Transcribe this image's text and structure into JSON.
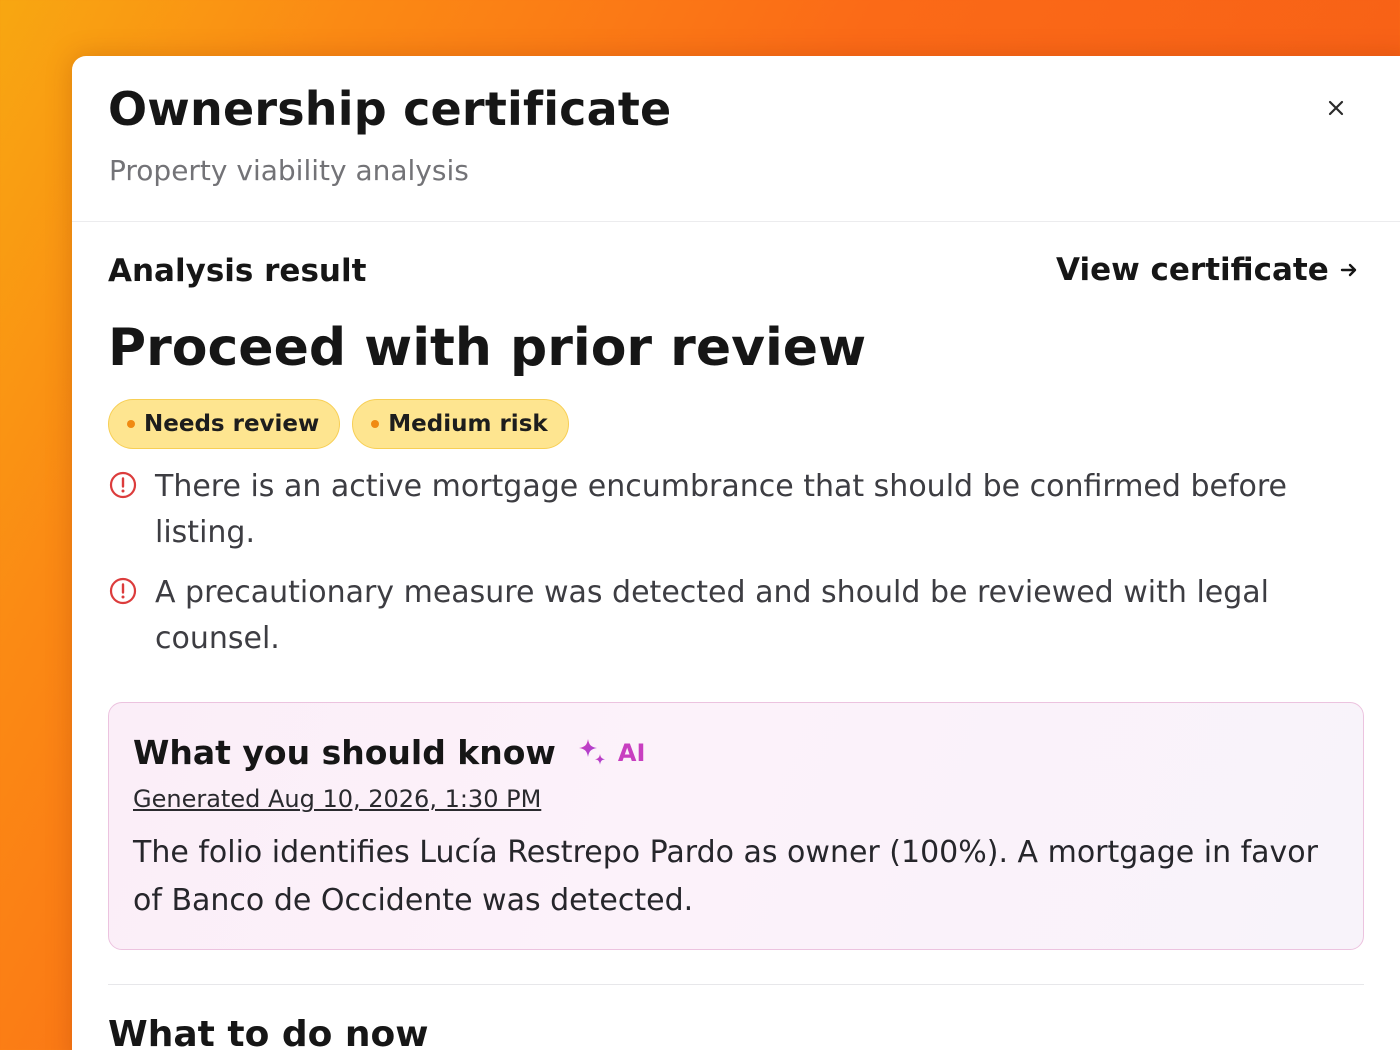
{
  "modal": {
    "title": "Ownership certificate",
    "subtitle": "Property viability analysis"
  },
  "analysis": {
    "section_label": "Analysis result",
    "view_certificate_label": "View certificate",
    "verdict": "Proceed with prior review",
    "badges": [
      {
        "label": "Needs review"
      },
      {
        "label": "Medium risk"
      }
    ],
    "warnings": [
      {
        "text": "There is an active mortgage encumbrance that should be confirmed before listing."
      },
      {
        "text": "A precautionary measure was detected and should be reviewed with legal counsel."
      }
    ]
  },
  "ai_summary": {
    "title": "What you should know",
    "tag": "AI",
    "generated": "Generated Aug 10, 2026, 1:30 PM",
    "body": "The folio identifies Lucía Restrepo Pardo as owner (100%). A mortgage in favor of Banco de Occidente was detected."
  },
  "next_steps": {
    "heading": "What to do now"
  },
  "icons": {
    "close": "close-icon",
    "arrow": "arrow-right-icon",
    "warning": "alert-circle-icon",
    "sparkle": "sparkle-icon"
  },
  "colors": {
    "badge_bg": "#fee590",
    "badge_dot": "#f08a12",
    "warning_icon": "#dc3c3c",
    "ai_accent": "#c83fc0",
    "background_gradient_start": "#f8a711",
    "background_gradient_end": "#f55a16"
  }
}
